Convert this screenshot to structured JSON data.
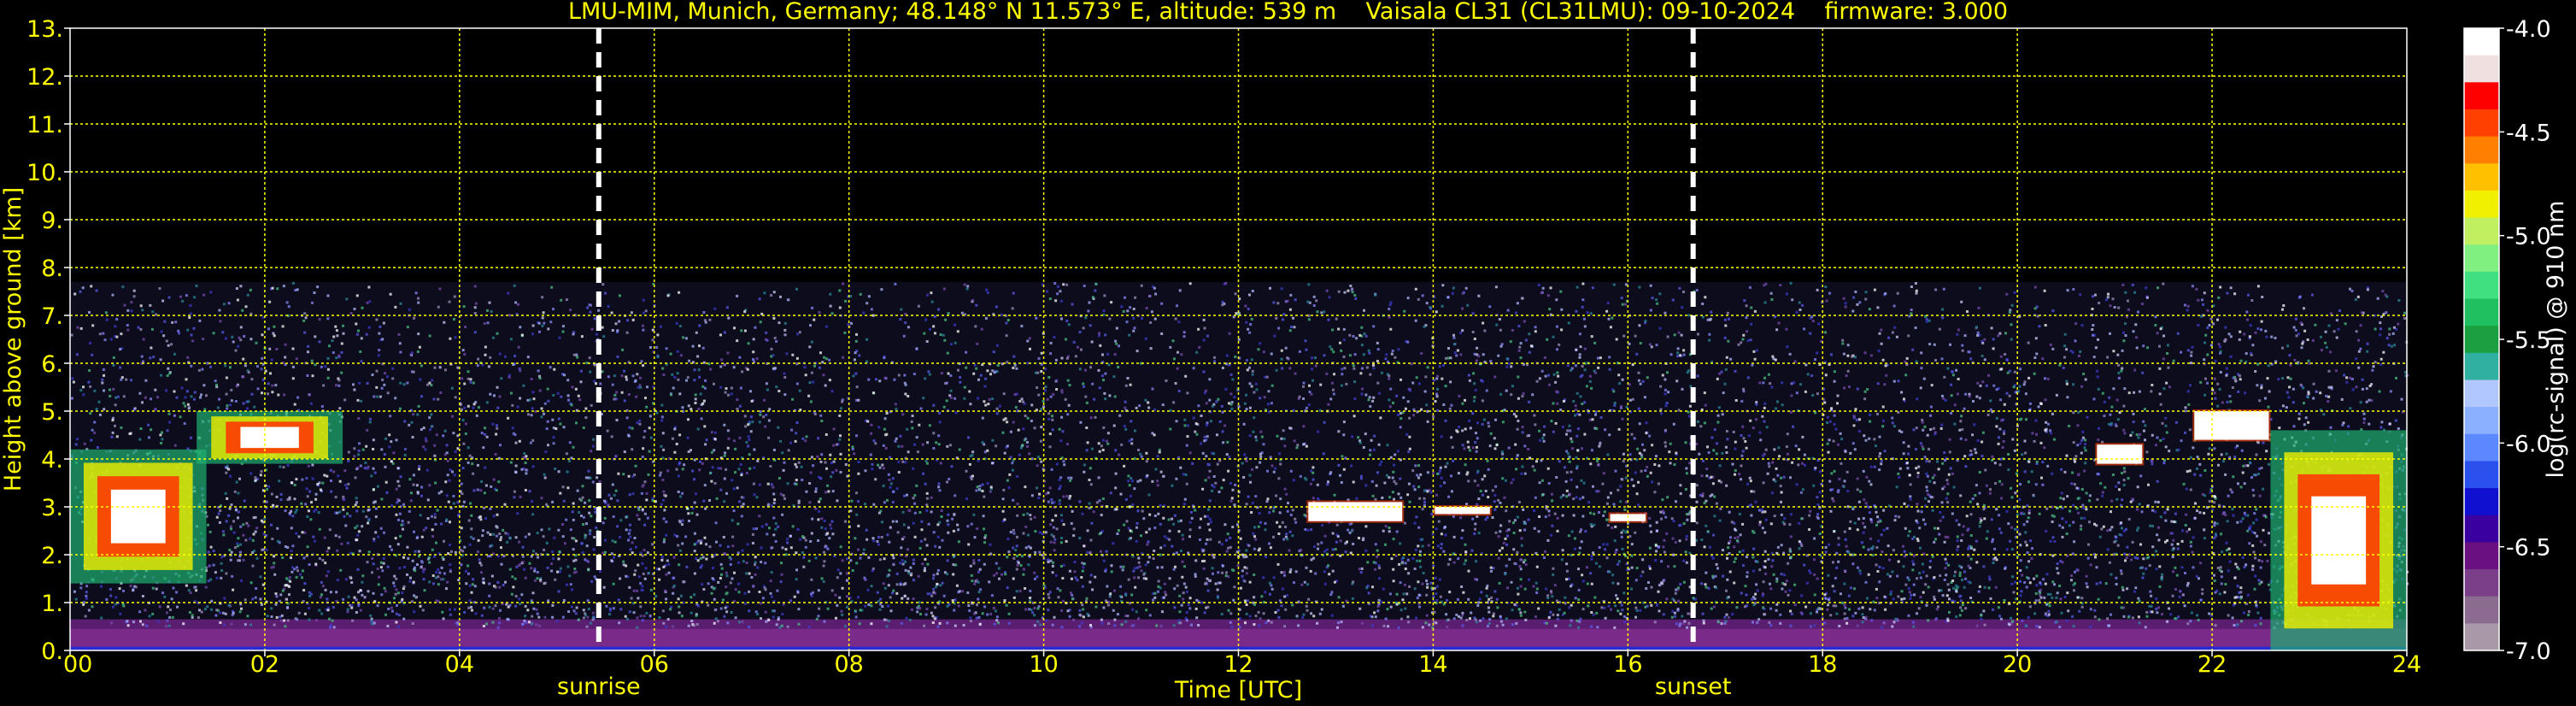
{
  "chart_data": {
    "type": "heatmap",
    "title": "LMU-MIM, Munich, Germany; 48.148° N 11.573° E, altitude: 539 m    Vaisala CL31 (CL31LMU): 09-10-2024    firmware: 3.000",
    "xlabel": "Time [UTC]",
    "ylabel": "Height above ground [km]",
    "xlim": [
      0,
      24
    ],
    "ylim": [
      0,
      13
    ],
    "x_ticks": [
      "00",
      "02",
      "04",
      "06",
      "08",
      "10",
      "12",
      "14",
      "16",
      "18",
      "20",
      "22",
      "24"
    ],
    "y_ticks": [
      "0.",
      "1.",
      "2.",
      "3.",
      "4.",
      "5.",
      "6.",
      "7.",
      "8.",
      "9.",
      "10.",
      "11.",
      "12.",
      "13."
    ],
    "grid": true,
    "colorbar": {
      "label": "log(rc-signal) @ 910 nm",
      "range": [
        -7.0,
        -4.0
      ],
      "ticks": [
        "-4.0",
        "-4.5",
        "-5.0",
        "-5.5",
        "-6.0",
        "-6.5",
        "-7.0"
      ],
      "colors": [
        "#a898a8",
        "#8b6b8f",
        "#7a3f88",
        "#6a1080",
        "#3a00a0",
        "#1010d0",
        "#2a50ee",
        "#5c88ff",
        "#8ab0ff",
        "#b0c8ff",
        "#30b0a0",
        "#1aa040",
        "#20c060",
        "#40e080",
        "#80f080",
        "#c0f060",
        "#f0f000",
        "#ffc000",
        "#ff8000",
        "#ff4000",
        "#ff0000",
        "#f0e0e0",
        "#ffffff"
      ]
    },
    "data_top_km": 7.7,
    "sun_events": [
      {
        "label": "sunrise",
        "time_h": 5.43
      },
      {
        "label": "sunset",
        "time_h": 16.67
      }
    ],
    "cloud_layers": [
      {
        "start_h": 0.0,
        "end_h": 1.4,
        "base_km": 1.4,
        "top_km": 4.2
      },
      {
        "start_h": 1.3,
        "end_h": 2.8,
        "base_km": 3.9,
        "top_km": 5.0
      },
      {
        "start_h": 12.7,
        "end_h": 13.7,
        "base_km": 2.7,
        "top_km": 3.1
      },
      {
        "start_h": 14.0,
        "end_h": 14.6,
        "base_km": 2.85,
        "top_km": 3.0
      },
      {
        "start_h": 15.8,
        "end_h": 16.2,
        "base_km": 2.7,
        "top_km": 2.85
      },
      {
        "start_h": 20.8,
        "end_h": 21.3,
        "base_km": 3.9,
        "top_km": 4.3
      },
      {
        "start_h": 21.8,
        "end_h": 22.6,
        "base_km": 4.4,
        "top_km": 5.0
      },
      {
        "start_h": 22.6,
        "end_h": 24.0,
        "base_km": 0.0,
        "top_km": 4.6
      }
    ]
  }
}
